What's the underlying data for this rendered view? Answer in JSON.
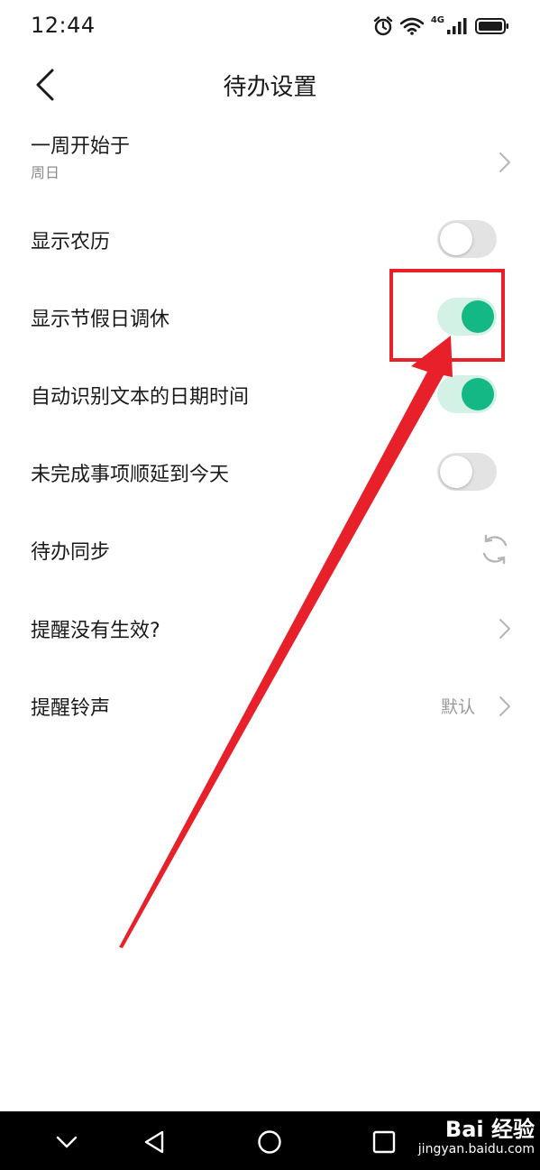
{
  "status_bar": {
    "time": "12:44",
    "network": "4G",
    "icons": [
      "alarm-icon",
      "wifi-icon",
      "cellular-signal-icon",
      "battery-icon"
    ]
  },
  "header": {
    "back_icon": "chevron-left-icon",
    "title": "待办设置"
  },
  "settings": {
    "week_start": {
      "label": "一周开始于",
      "value": "周日"
    },
    "show_lunar": {
      "label": "显示农历",
      "enabled": false
    },
    "show_holiday": {
      "label": "显示节假日调休",
      "enabled": true
    },
    "auto_detect_date": {
      "label": "自动识别文本的日期时间",
      "enabled": true
    },
    "postpone_unfinished": {
      "label": "未完成事项顺延到今天",
      "enabled": false
    },
    "todo_sync": {
      "label": "待办同步",
      "icon": "sync-icon"
    },
    "reminder_not_working": {
      "label": "提醒没有生效?"
    },
    "reminder_ringtone": {
      "label": "提醒铃声",
      "value": "默认"
    }
  },
  "annotation": {
    "color": "#e8202a"
  },
  "colors": {
    "toggle_on_track": "#d4f1e6",
    "toggle_on_knob": "#14b884",
    "toggle_off_track": "#e3e3e3",
    "secondary_text": "#8c8c8c"
  },
  "nav_bar": {
    "icons": [
      "nav-down-icon",
      "nav-back-icon",
      "nav-home-icon",
      "nav-recents-icon"
    ]
  },
  "watermark": {
    "brand": "Bai 经验",
    "url": "jingyan.baidu.com"
  }
}
